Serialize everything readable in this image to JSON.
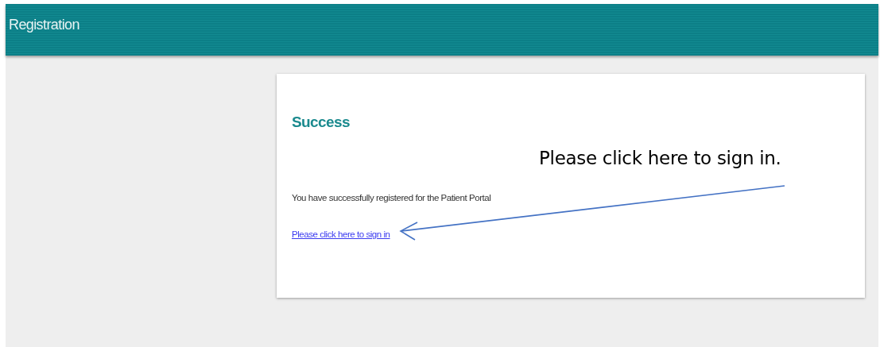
{
  "header": {
    "title": "Registration"
  },
  "card": {
    "heading": "Success",
    "message": "You have successfully registered for the Patient Portal",
    "link": "Please click here to sign in"
  },
  "annotation": {
    "text": "Please click here to sign in."
  }
}
